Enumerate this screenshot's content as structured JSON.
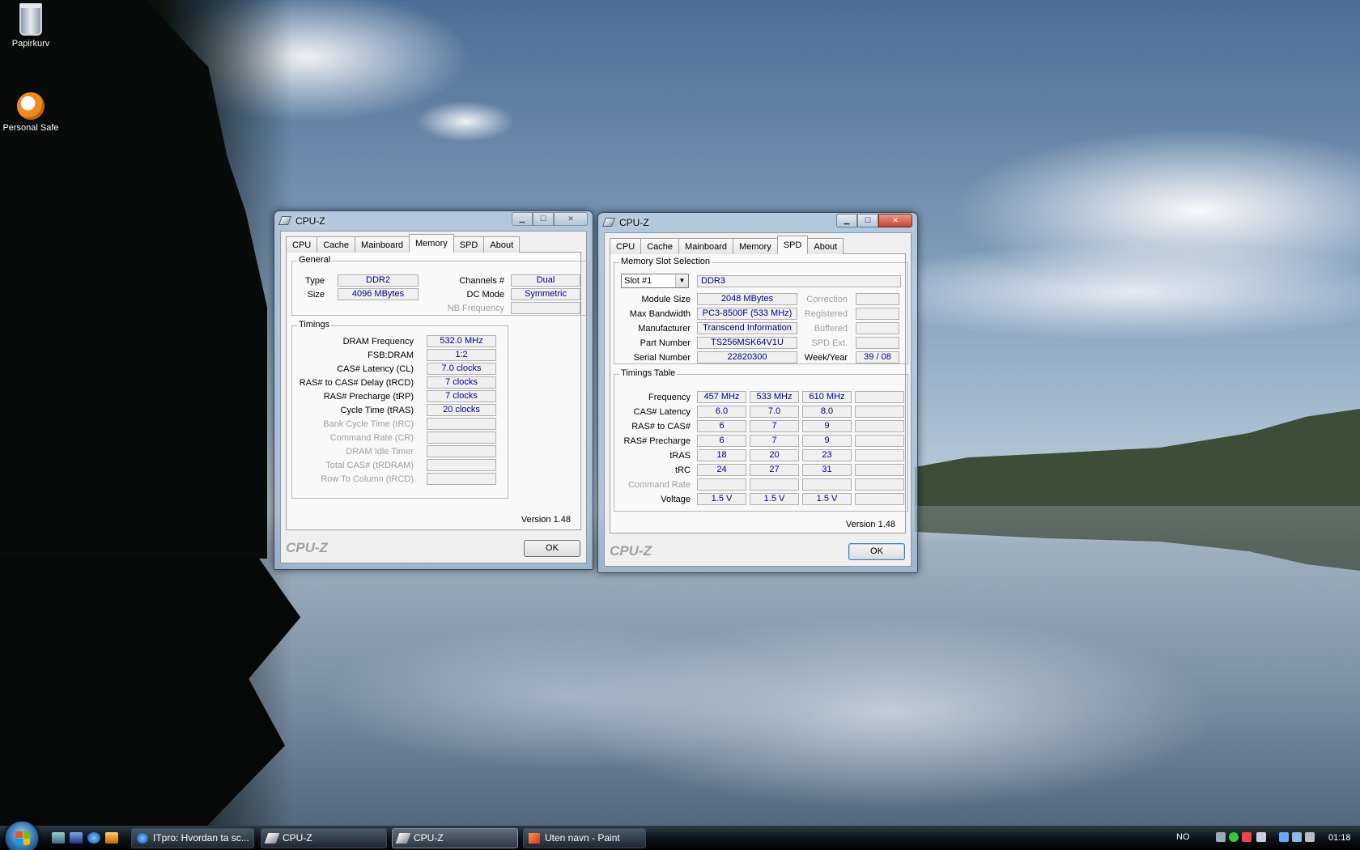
{
  "desktop": {
    "icons": [
      {
        "label": "Papirkurv",
        "icon": "recycle-bin-icon"
      },
      {
        "label": "Personal Safe",
        "icon": "personal-safe-icon"
      }
    ]
  },
  "window_left": {
    "title": "CPU-Z",
    "tabs": [
      "CPU",
      "Cache",
      "Mainboard",
      "Memory",
      "SPD",
      "About"
    ],
    "selected_tab": "Memory",
    "general": {
      "title": "General",
      "type_label": "Type",
      "type_value": "DDR2",
      "size_label": "Size",
      "size_value": "4096 MBytes",
      "channels_label": "Channels #",
      "channels_value": "Dual",
      "dcmode_label": "DC Mode",
      "dcmode_value": "Symmetric",
      "nbfreq_label": "NB Frequency",
      "nbfreq_value": ""
    },
    "timings": {
      "title": "Timings",
      "rows": [
        {
          "label": "DRAM Frequency",
          "value": "532.0 MHz",
          "enabled": true
        },
        {
          "label": "FSB:DRAM",
          "value": "1:2",
          "enabled": true
        },
        {
          "label": "CAS# Latency (CL)",
          "value": "7.0 clocks",
          "enabled": true
        },
        {
          "label": "RAS# to CAS# Delay (tRCD)",
          "value": "7 clocks",
          "enabled": true
        },
        {
          "label": "RAS# Precharge (tRP)",
          "value": "7 clocks",
          "enabled": true
        },
        {
          "label": "Cycle Time (tRAS)",
          "value": "20 clocks",
          "enabled": true
        },
        {
          "label": "Bank Cycle Time (tRC)",
          "value": "",
          "enabled": false
        },
        {
          "label": "Command Rate (CR)",
          "value": "",
          "enabled": false
        },
        {
          "label": "DRAM Idle Timer",
          "value": "",
          "enabled": false
        },
        {
          "label": "Total CAS# (tRDRAM)",
          "value": "",
          "enabled": false
        },
        {
          "label": "Row To Column (tRCD)",
          "value": "",
          "enabled": false
        }
      ]
    },
    "version": "Version 1.48",
    "brand": "CPU-Z",
    "ok_label": "OK"
  },
  "window_right": {
    "title": "CPU-Z",
    "tabs": [
      "CPU",
      "Cache",
      "Mainboard",
      "Memory",
      "SPD",
      "About"
    ],
    "selected_tab": "SPD",
    "slot": {
      "title": "Memory Slot Selection",
      "selected": "Slot #1",
      "type": "DDR3",
      "rows": [
        {
          "label": "Module Size",
          "value": "2048 MBytes",
          "rlabel": "Correction",
          "rvalue": ""
        },
        {
          "label": "Max Bandwidth",
          "value": "PC3-8500F (533 MHz)",
          "rlabel": "Registered",
          "rvalue": ""
        },
        {
          "label": "Manufacturer",
          "value": "Transcend Information",
          "rlabel": "Buffered",
          "rvalue": ""
        },
        {
          "label": "Part Number",
          "value": "TS256MSK64V1U",
          "rlabel": "SPD Ext.",
          "rvalue": ""
        },
        {
          "label": "Serial Number",
          "value": "22820300",
          "rlabel": "Week/Year",
          "rvalue": "39 / 08"
        }
      ]
    },
    "timings_table": {
      "title": "Timings Table",
      "rows": [
        {
          "label": "Frequency",
          "values": [
            "457 MHz",
            "533 MHz",
            "610 MHz",
            ""
          ],
          "enabled": true
        },
        {
          "label": "CAS# Latency",
          "values": [
            "6.0",
            "7.0",
            "8.0",
            ""
          ],
          "enabled": true
        },
        {
          "label": "RAS# to CAS#",
          "values": [
            "6",
            "7",
            "9",
            ""
          ],
          "enabled": true
        },
        {
          "label": "RAS# Precharge",
          "values": [
            "6",
            "7",
            "9",
            ""
          ],
          "enabled": true
        },
        {
          "label": "tRAS",
          "values": [
            "18",
            "20",
            "23",
            ""
          ],
          "enabled": true
        },
        {
          "label": "tRC",
          "values": [
            "24",
            "27",
            "31",
            ""
          ],
          "enabled": true
        },
        {
          "label": "Command Rate",
          "values": [
            "",
            "",
            "",
            ""
          ],
          "enabled": false
        },
        {
          "label": "Voltage",
          "values": [
            "1.5 V",
            "1.5 V",
            "1.5 V",
            ""
          ],
          "enabled": true
        }
      ]
    },
    "version": "Version 1.48",
    "brand": "CPU-Z",
    "ok_label": "OK"
  },
  "taskbar": {
    "items": [
      {
        "label": "ITpro: Hvordan ta sc...",
        "icon": "internet-explorer-icon"
      },
      {
        "label": "CPU-Z",
        "icon": "cpuz-icon"
      },
      {
        "label": "CPU-Z",
        "icon": "cpuz-icon"
      },
      {
        "label": "Uten navn - Paint",
        "icon": "paint-icon"
      }
    ],
    "language": "NO",
    "clock": "01:18"
  },
  "colors": {
    "value_text": "#00008b",
    "disabled_text": "#a0a0a0"
  }
}
